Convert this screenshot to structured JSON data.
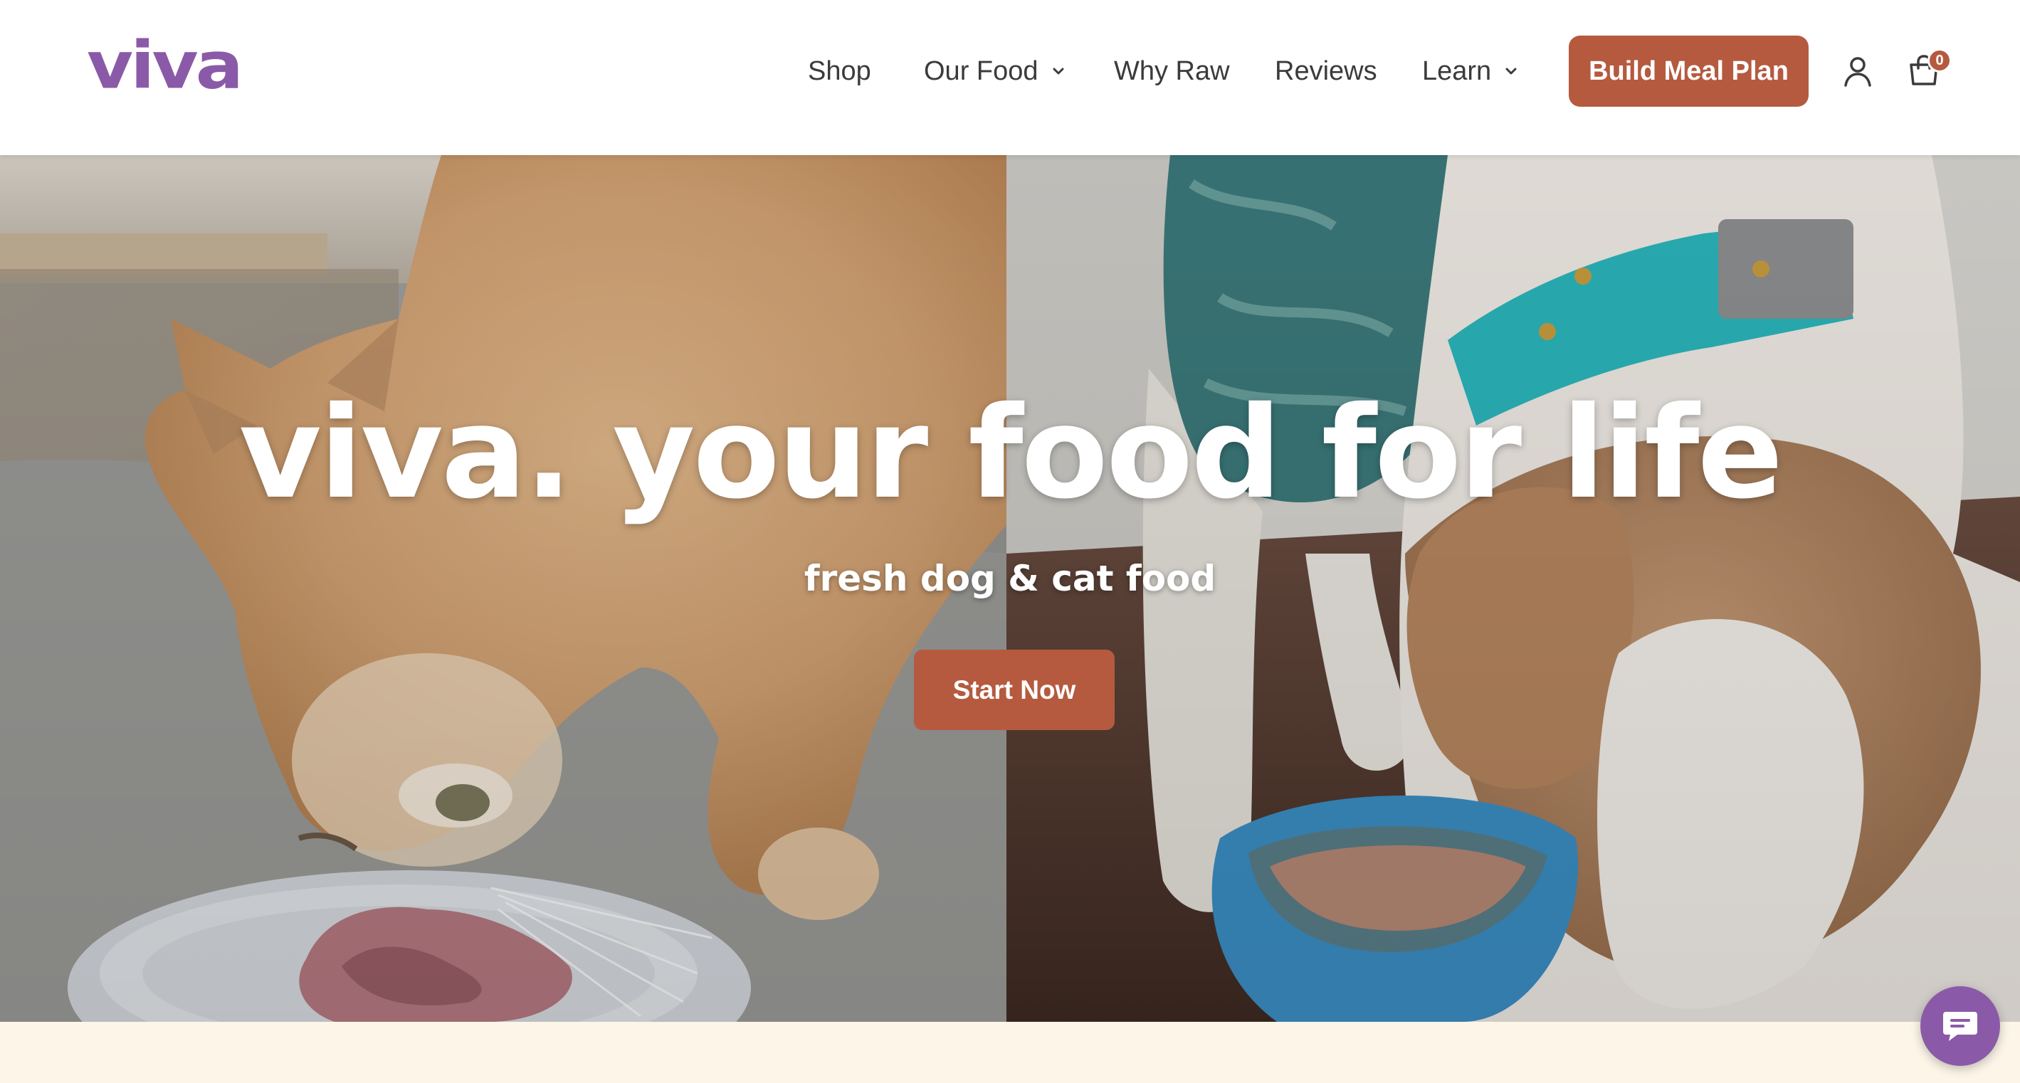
{
  "header": {
    "logo_text": "viva",
    "nav": [
      {
        "label": "Shop",
        "has_dropdown": false
      },
      {
        "label": "Our Food",
        "has_dropdown": true
      },
      {
        "label": "Why Raw",
        "has_dropdown": false
      },
      {
        "label": "Reviews",
        "has_dropdown": false
      },
      {
        "label": "Learn",
        "has_dropdown": true
      }
    ],
    "cta_label": "Build Meal Plan",
    "account_icon": "person-icon",
    "cart_icon": "shopping-bag-icon",
    "cart_count": "0"
  },
  "hero": {
    "title": "viva. your food for life",
    "subtitle": "fresh dog & cat food",
    "cta_label": "Start Now",
    "left_image": "orange cat eating raw food from white plate",
    "right_image": "dog with teal collar eating from blue bowl"
  },
  "chat": {
    "icon": "chat-bubble-icon"
  },
  "colors": {
    "brand_purple": "#8a5aa8",
    "accent_terracotta": "#b55a3f",
    "cream": "#fcf5e8",
    "nav_text": "#3b3b3b"
  }
}
